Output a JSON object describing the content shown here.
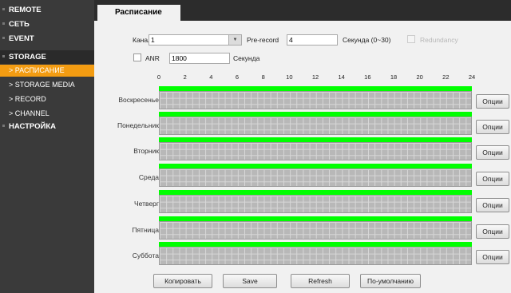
{
  "sidebar": {
    "items": [
      {
        "label": "REMOTE"
      },
      {
        "label": "СЕТЬ"
      },
      {
        "label": "EVENT"
      },
      {
        "label": "STORAGE"
      },
      {
        "label": "> РАСПИСАНИЕ"
      },
      {
        "label": "> STORAGE MEDIA"
      },
      {
        "label": "> RECORD"
      },
      {
        "label": "> CHANNEL"
      },
      {
        "label": "НАСТРОЙКА"
      }
    ]
  },
  "tab": {
    "label": "Расписание"
  },
  "form": {
    "channel_label": "Канал",
    "channel_value": "1",
    "prerecord_label": "Pre-record",
    "prerecord_value": "4",
    "prerecord_unit": "Секунда (0~30)",
    "redundancy_label": "Redundancy",
    "anr_label": "ANR",
    "anr_value": "1800",
    "anr_unit": "Секунда"
  },
  "schedule": {
    "hours": [
      "0",
      "2",
      "4",
      "6",
      "8",
      "10",
      "12",
      "14",
      "16",
      "18",
      "20",
      "22",
      "24"
    ],
    "days": [
      {
        "label": "Воскресенье",
        "button": "Опции"
      },
      {
        "label": "Понедельник",
        "button": "Опции"
      },
      {
        "label": "Вторник",
        "button": "Опции"
      },
      {
        "label": "Среда",
        "button": "Опции"
      },
      {
        "label": "Четверг",
        "button": "Опции"
      },
      {
        "label": "Пятница",
        "button": "Опции"
      },
      {
        "label": "Суббота",
        "button": "Опции"
      }
    ]
  },
  "actions": {
    "copy": "Копировать",
    "save": "Save",
    "refresh": "Refresh",
    "default": "По-умолчанию"
  },
  "colors": {
    "sidebar_bg": "#3a3a3a",
    "active_item": "#f39c12",
    "schedule_bar": "#00ff00"
  }
}
